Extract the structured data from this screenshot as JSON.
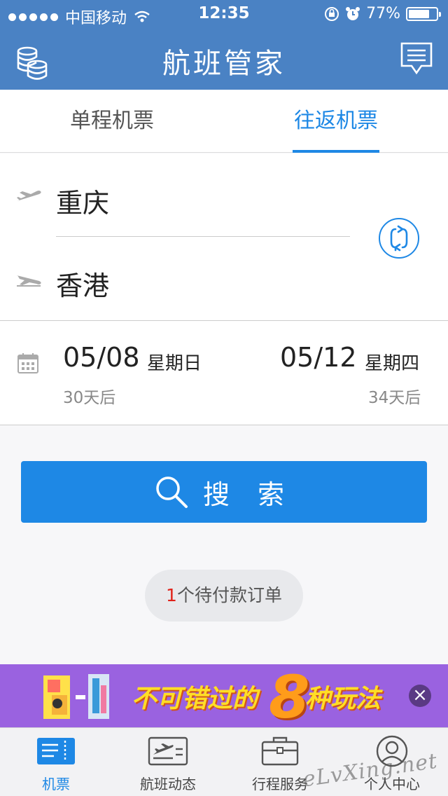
{
  "status_bar": {
    "carrier": "中国移动",
    "time": "12:35",
    "battery": "77%",
    "battery_level": 0.77
  },
  "nav": {
    "title": "航班管家",
    "left_icon": "coins-icon",
    "right_icon": "message-icon"
  },
  "tabs": [
    {
      "label": "单程机票",
      "active": false
    },
    {
      "label": "往返机票",
      "active": true
    }
  ],
  "route": {
    "from": "重庆",
    "to": "香港",
    "swap_icon": "swap-icon"
  },
  "dates": {
    "depart": {
      "date": "05/08",
      "weekday": "星期日",
      "days": "30天后"
    },
    "return": {
      "date": "05/12",
      "weekday": "星期四",
      "days": "34天后"
    }
  },
  "search": {
    "label": "搜 索"
  },
  "pending": {
    "count": "1",
    "text": "个待付款订单"
  },
  "banner": {
    "slogan_a": "不可错过的",
    "slogan_big": "8",
    "slogan_b": "种玩法",
    "close": "×"
  },
  "tabbar": [
    {
      "label": "机票",
      "icon": "ticket-icon",
      "active": true
    },
    {
      "label": "航班动态",
      "icon": "flight-status-icon",
      "active": false
    },
    {
      "label": "行程服务",
      "icon": "briefcase-icon",
      "active": false
    },
    {
      "label": "个人中心",
      "icon": "person-icon",
      "active": false
    }
  ],
  "watermark": "eLvXing.net",
  "colors": {
    "nav_bg": "#4a82c4",
    "accent": "#1e88e5",
    "banner_bg": "#9a62e0"
  }
}
